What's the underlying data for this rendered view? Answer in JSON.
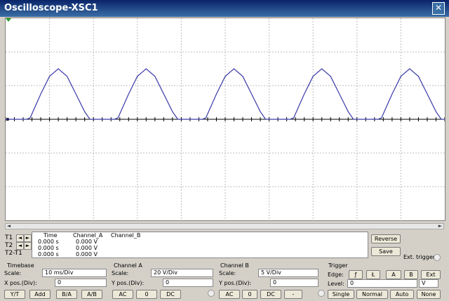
{
  "window": {
    "title": "Oscilloscope-XSC1",
    "close_glyph": "✕"
  },
  "readout": {
    "headers": {
      "time": "Time",
      "channel_a": "Channel_A",
      "channel_b": "Channel_B"
    },
    "rows": [
      {
        "label": "T1",
        "time": "0.000 s",
        "channel_a": "0.000 V"
      },
      {
        "label": "T2",
        "time": "0.000 s",
        "channel_a": "0.000 V"
      },
      {
        "label": "T2-T1",
        "time": "0.000 s",
        "channel_a": "0.000 V"
      }
    ],
    "left_arrow": "◄",
    "right_arrow": "►"
  },
  "buttons": {
    "reverse": "Reverse",
    "save": "Save",
    "ext_trigger": "Ext. trigger"
  },
  "timebase": {
    "title": "Timebase",
    "scale_label": "Scale:",
    "scale_value": "10 ms/Div",
    "xpos_label": "X pos.(Div):",
    "xpos_value": "0",
    "modes": [
      "Y/T",
      "Add",
      "B/A",
      "A/B"
    ]
  },
  "channel_a": {
    "title": "Channel A",
    "scale_label": "Scale:",
    "scale_value": "20  V/Div",
    "ypos_label": "Y pos.(Div):",
    "ypos_value": "0",
    "couplings": [
      "AC",
      "0",
      "DC"
    ]
  },
  "channel_b": {
    "title": "Channel B",
    "scale_label": "Scale:",
    "scale_value": "5  V/Div",
    "ypos_label": "Y pos.(Div):",
    "ypos_value": "0",
    "couplings": [
      "AC",
      "0",
      "DC",
      "-"
    ]
  },
  "trigger": {
    "title": "Trigger",
    "edge_label": "Edge:",
    "edge_rise": "ƒ",
    "edge_fall": "Ł",
    "sources": [
      "A",
      "B",
      "Ext"
    ],
    "level_label": "Level:",
    "level_value": "0",
    "level_unit": "V",
    "modes": [
      "Single",
      "Normal",
      "Auto",
      "None"
    ]
  },
  "colors": {
    "trace": "#3a3aa8",
    "grid": "#bdbdbd",
    "axis": "#000000"
  },
  "chart_data": {
    "type": "line",
    "series": [
      {
        "values": [
          [
            0,
            0
          ],
          [
            12,
            0
          ],
          [
            14,
            0.6
          ],
          [
            20,
            10
          ],
          [
            25,
            17
          ],
          [
            30,
            20
          ],
          [
            35,
            17
          ],
          [
            40,
            10
          ],
          [
            45,
            3
          ],
          [
            48,
            0
          ],
          [
            62,
            0
          ],
          [
            64,
            0.6
          ],
          [
            70,
            10
          ],
          [
            75,
            17
          ],
          [
            80,
            20
          ],
          [
            85,
            17
          ],
          [
            90,
            10
          ],
          [
            95,
            3
          ],
          [
            98,
            0
          ],
          [
            112,
            0
          ],
          [
            114,
            0.6
          ],
          [
            120,
            10
          ],
          [
            125,
            17
          ],
          [
            130,
            20
          ],
          [
            135,
            17
          ],
          [
            140,
            10
          ],
          [
            145,
            3
          ],
          [
            148,
            0
          ],
          [
            162,
            0
          ],
          [
            164,
            0.6
          ],
          [
            170,
            10
          ],
          [
            175,
            17
          ],
          [
            180,
            20
          ],
          [
            185,
            17
          ],
          [
            190,
            10
          ],
          [
            195,
            3
          ],
          [
            198,
            0
          ],
          [
            212,
            0
          ],
          [
            214,
            0.6
          ],
          [
            220,
            10
          ],
          [
            225,
            17
          ],
          [
            230,
            20
          ],
          [
            235,
            17
          ],
          [
            240,
            10
          ],
          [
            245,
            3
          ],
          [
            248,
            0
          ],
          [
            250,
            0
          ]
        ]
      }
    ],
    "x_unit": "ms",
    "y_unit": "V",
    "xlim": [
      0,
      250
    ],
    "ylim": [
      -40,
      40
    ],
    "grid": true
  }
}
